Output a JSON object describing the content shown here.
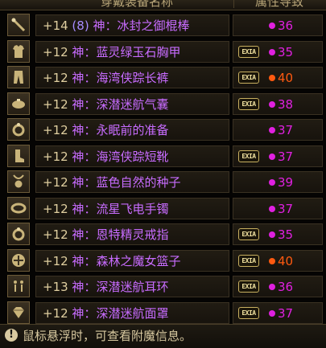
{
  "header": {
    "name_col": "穿戴装备名称",
    "attr_col": "属性导致"
  },
  "colors": {
    "magenta": "#e020e0",
    "orange": "#ff5a10",
    "name_purple": "#c86cff",
    "slot_blue": "#a78cff"
  },
  "items": [
    {
      "icon": "staff-icon",
      "plus": "+14",
      "slot": "(8)",
      "prefix": "神：",
      "name": "冰封之御棍棒",
      "badge": "",
      "dot_color": "#e020e0",
      "value": "36"
    },
    {
      "icon": "armor-icon",
      "plus": "+12",
      "slot": "",
      "prefix": "神：",
      "name": "蓝灵绿玉石胸甲",
      "badge": "EXIA",
      "dot_color": "#e020e0",
      "value": "35"
    },
    {
      "icon": "pants-icon",
      "plus": "+12",
      "slot": "",
      "prefix": "神：",
      "name": "海湾侠踪长裤",
      "badge": "EXIA",
      "dot_color": "#ff5a10",
      "value": "40"
    },
    {
      "icon": "pouch-icon",
      "plus": "+12",
      "slot": "",
      "prefix": "神：",
      "name": "深潜迷航气囊",
      "badge": "EXIA",
      "dot_color": "#e020e0",
      "value": "38"
    },
    {
      "icon": "ring-icon",
      "plus": "+12",
      "slot": "",
      "prefix": "神：",
      "name": "永眠前的准备",
      "badge": "",
      "dot_color": "#e020e0",
      "value": "37"
    },
    {
      "icon": "boots-icon",
      "plus": "+12",
      "slot": "",
      "prefix": "神：",
      "name": "海湾侠踪短靴",
      "badge": "EXIA",
      "dot_color": "#e020e0",
      "value": "37"
    },
    {
      "icon": "amulet-icon",
      "plus": "+12",
      "slot": "",
      "prefix": "神：",
      "name": "蓝色自然的种子",
      "badge": "",
      "dot_color": "#e020e0",
      "value": "39"
    },
    {
      "icon": "bracelet-icon",
      "plus": "+12",
      "slot": "",
      "prefix": "神：",
      "name": "流星飞电手镯",
      "badge": "",
      "dot_color": "#e020e0",
      "value": "37"
    },
    {
      "icon": "ring-icon",
      "plus": "+12",
      "slot": "",
      "prefix": "神：",
      "name": "恩特精灵戒指",
      "badge": "EXIA",
      "dot_color": "#e020e0",
      "value": "35"
    },
    {
      "icon": "orb-icon",
      "plus": "+12",
      "slot": "",
      "prefix": "神：",
      "name": "森林之魔女篮子",
      "badge": "EXIA",
      "dot_color": "#ff5a10",
      "value": "40"
    },
    {
      "icon": "earring-icon",
      "plus": "+13",
      "slot": "",
      "prefix": "神：",
      "name": "深潜迷航耳环",
      "badge": "EXIA",
      "dot_color": "#e020e0",
      "value": "36"
    },
    {
      "icon": "gem-icon",
      "plus": "+12",
      "slot": "",
      "prefix": "神：",
      "name": "深潜迷航面罩",
      "badge": "EXIA",
      "dot_color": "#e020e0",
      "value": "37"
    }
  ],
  "footer": {
    "hint": "鼠标悬浮时，可查看附魔信息。"
  }
}
